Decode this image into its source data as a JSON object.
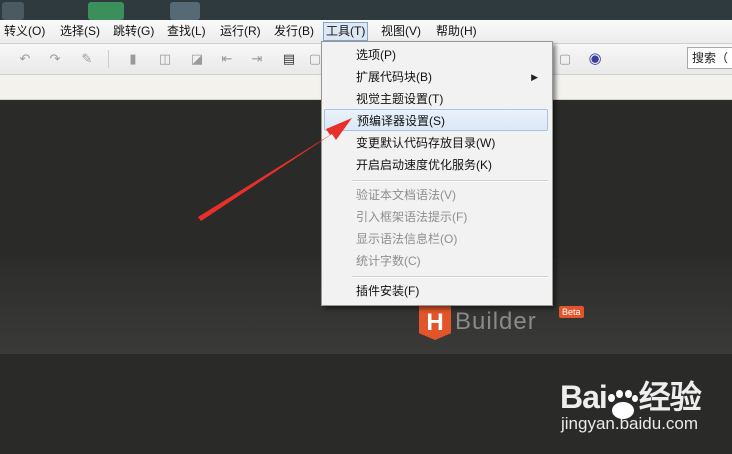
{
  "menubar": {
    "items": [
      {
        "label": "转义(O)"
      },
      {
        "label": "选择(S)"
      },
      {
        "label": "跳转(G)"
      },
      {
        "label": "查找(L)"
      },
      {
        "label": "运行(R)"
      },
      {
        "label": "发行(B)"
      },
      {
        "label": "工具(T)"
      },
      {
        "label": "视图(V)"
      },
      {
        "label": "帮助(H)"
      }
    ],
    "active": "工具(T)"
  },
  "toolbar": {
    "search_label": "搜索（",
    "icons": [
      "undo-icon",
      "redo-icon",
      "format-icon",
      "bookmark-icon",
      "bookmark-prev-icon",
      "bookmark-next-icon",
      "step-into-icon",
      "step-out-icon",
      "comment-icon",
      "browser-icon"
    ]
  },
  "tools_menu": {
    "items": [
      {
        "label": "选项(P)",
        "enabled": true
      },
      {
        "label": "扩展代码块(B)",
        "enabled": true,
        "submenu": true
      },
      {
        "label": "视觉主题设置(T)",
        "enabled": true
      },
      {
        "label": "预编译器设置(S)",
        "enabled": true,
        "highlighted": true
      },
      {
        "label": "变更默认代码存放目录(W)",
        "enabled": true
      },
      {
        "label": "开启启动速度优化服务(K)",
        "enabled": true
      },
      {
        "label": "验证本文档语法(V)",
        "enabled": false
      },
      {
        "label": "引入框架语法提示(F)",
        "enabled": false
      },
      {
        "label": "显示语法信息栏(O)",
        "enabled": false
      },
      {
        "label": "统计字数(C)",
        "enabled": false
      },
      {
        "label": "插件安装(F)",
        "enabled": true
      }
    ]
  },
  "logo": {
    "letter": "H",
    "name": "Builder",
    "badge": "Beta"
  },
  "watermark": {
    "brand_left": "Bai",
    "brand_right": "经验",
    "url": "jingyan.baidu.com"
  },
  "colors": {
    "accent": "#e2552a",
    "arrow": "#e8302a",
    "menu_highlight": "#dbe8f6",
    "editor_bg": "#2a2a28"
  }
}
